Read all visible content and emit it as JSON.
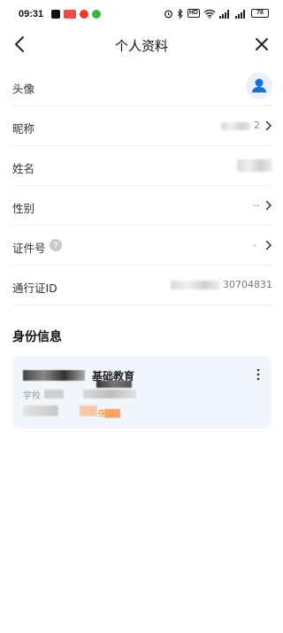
{
  "status_bar": {
    "time": "09:31",
    "battery": "78",
    "hd_label": "HD",
    "app_icons": [
      "#111111",
      "#e94b4b",
      "#e63b2e",
      "#3bb54a"
    ],
    "icons": [
      "alarm-icon",
      "bluetooth-icon",
      "hd-icon",
      "wifi-icon",
      "signal-icon",
      "signal-icon",
      "battery-icon"
    ]
  },
  "nav": {
    "title": "个人资料",
    "back_icon": "back-arrow-icon",
    "close_icon": "close-icon"
  },
  "profile": {
    "rows": [
      {
        "label": "头像",
        "icon": "avatar-icon"
      },
      {
        "label": "昵称",
        "value": "2"
      },
      {
        "label": "姓名",
        "value": ""
      },
      {
        "label": "性别",
        "value": "--"
      },
      {
        "label": "证件号",
        "value": "-",
        "help_icon": "?"
      },
      {
        "label": "通行证ID",
        "value": "30704831"
      }
    ]
  },
  "identity": {
    "title": "身份信息",
    "card": {
      "name": "基础教育",
      "sub": "学校",
      "tag": "身份"
    }
  },
  "colors": {
    "accent": "#1a6fd6",
    "avatar_bg": "#e9f1fc",
    "card_bg": "#f2f6fc",
    "tag_orange": "#f08a3c",
    "divider": "#eeeeee"
  }
}
